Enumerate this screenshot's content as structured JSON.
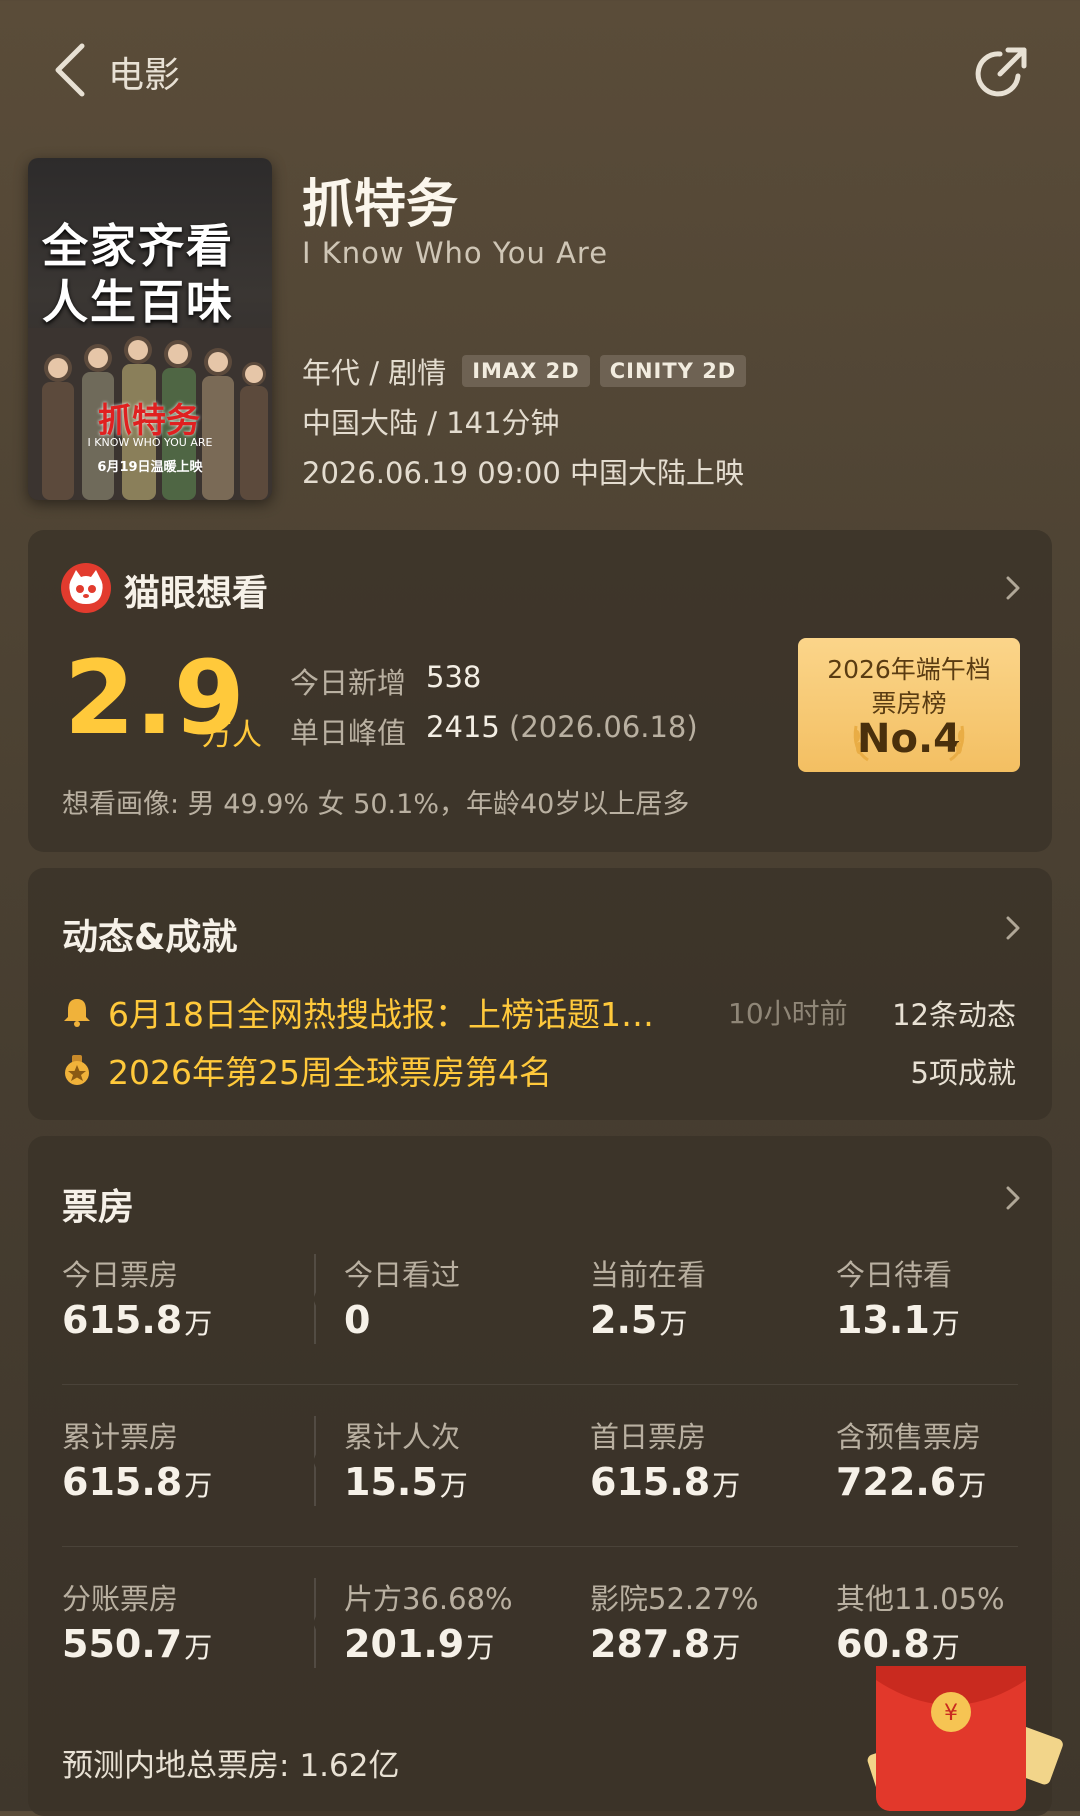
{
  "nav": {
    "back_label": "电影"
  },
  "poster": {
    "slogan_line1": "全家齐看",
    "slogan_line2": "人生百味",
    "title": "抓特务",
    "english": "I KNOW WHO YOU ARE",
    "release": "6月19日温暖上映"
  },
  "movie": {
    "title": "抓特务",
    "english_title": "I Know Who You Are",
    "genres": "年代 / 剧情",
    "badges": [
      "IMAX 2D",
      "CINITY 2D"
    ],
    "region_duration": "中国大陆 / 141分钟",
    "release": "2026.06.19 09:00 中国大陆上映"
  },
  "want": {
    "title": "猫眼想看",
    "count": "2.9",
    "unit": "万人",
    "today_label": "今日新增",
    "today_value": "538",
    "peak_label": "单日峰值",
    "peak_value": "2415",
    "peak_date": "(2026.06.18)",
    "portrait": "想看画像: 男 49.9%  女 50.1%，年龄40岁以上居多",
    "rank_line1": "2026年端午档",
    "rank_line2": "票房榜",
    "rank_no": "No.4"
  },
  "dynamics": {
    "title": "动态&成就",
    "news_text": "6月18日全网热搜战报：上榜话题1…",
    "news_time": "10小时前",
    "news_count": "12条动态",
    "achievement_text": "2026年第25周全球票房第4名",
    "achievement_count": "5项成就"
  },
  "boxoffice": {
    "title": "票房",
    "rows": [
      [
        {
          "label": "今日票房",
          "value": "615.8",
          "unit": "万"
        },
        {
          "label": "今日看过",
          "value": "0",
          "unit": ""
        },
        {
          "label": "当前在看",
          "value": "2.5",
          "unit": "万"
        },
        {
          "label": "今日待看",
          "value": "13.1",
          "unit": "万"
        }
      ],
      [
        {
          "label": "累计票房",
          "value": "615.8",
          "unit": "万"
        },
        {
          "label": "累计人次",
          "value": "15.5",
          "unit": "万"
        },
        {
          "label": "首日票房",
          "value": "615.8",
          "unit": "万"
        },
        {
          "label": "含预售票房",
          "value": "722.6",
          "unit": "万"
        }
      ],
      [
        {
          "label": "分账票房",
          "value": "550.7",
          "unit": "万"
        },
        {
          "label": "片方36.68%",
          "value": "201.9",
          "unit": "万"
        },
        {
          "label": "影院52.27%",
          "value": "287.8",
          "unit": "万"
        },
        {
          "label": "其他11.05%",
          "value": "60.8",
          "unit": "万"
        }
      ]
    ],
    "forecast_label": "预测内地总票房:",
    "forecast_value": "1.62亿"
  },
  "colors": {
    "accent": "#ffc93b",
    "background": "#4f4434",
    "card": "#3a3228",
    "maoyan_red": "#e23b2e"
  }
}
